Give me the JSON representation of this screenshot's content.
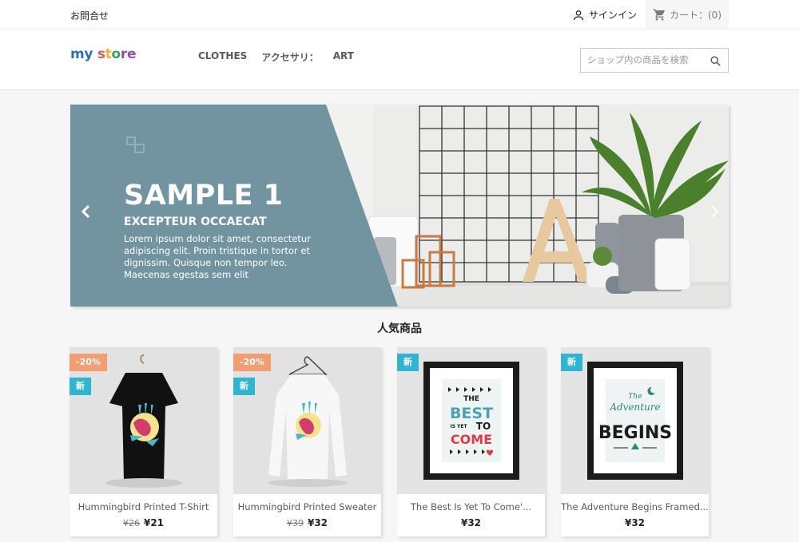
{
  "topbar": {
    "contact_label": "お問合せ",
    "signin_label": "サインイン",
    "cart_label": "カート：(0)"
  },
  "header": {
    "logo": {
      "part1": "my",
      "part2": "s",
      "part3": "t",
      "part4": "o",
      "part5": "re"
    },
    "nav": [
      {
        "label": "CLOTHES"
      },
      {
        "label": "アクセサリ："
      },
      {
        "label": "ART"
      }
    ],
    "search": {
      "placeholder": "ショップ内の商品を検索",
      "value": ""
    }
  },
  "carousel": {
    "title": "SAMPLE 1",
    "subtitle": "EXCEPTEUR OCCAECAT",
    "text": "Lorem ipsum dolor sit amet, consectetur adipiscing elit. Proin tristique in tortor et dignissim. Quisque non tempor leo. Maecenas egestas sem elit",
    "panel_color": "#7293a0"
  },
  "section": {
    "title": "人気商品"
  },
  "products": [
    {
      "name": "Hummingbird Printed T-Shirt",
      "old_price": "¥26",
      "price": "¥21",
      "discount": "-20%",
      "new": "新"
    },
    {
      "name": "Hummingbird Printed Sweater",
      "old_price": "¥39",
      "price": "¥32",
      "discount": "-20%",
      "new": "新"
    },
    {
      "name": "The Best Is Yet To Come'...",
      "price": "¥32",
      "new": "新"
    },
    {
      "name": "The Adventure Begins Framed...",
      "price": "¥32",
      "new": "新"
    }
  ],
  "poster": {
    "best_line1": "THE",
    "best_line2": "BEST",
    "best_line3a": "IS YET",
    "best_line3b": "TO",
    "best_line4": "COME",
    "adv_line1": "The",
    "adv_line2": "Adventure",
    "adv_line3": "BEGINS"
  },
  "colors": {
    "brand_blue": "#2fb5d2",
    "discount": "#f39d72",
    "panel": "#7293a0"
  }
}
